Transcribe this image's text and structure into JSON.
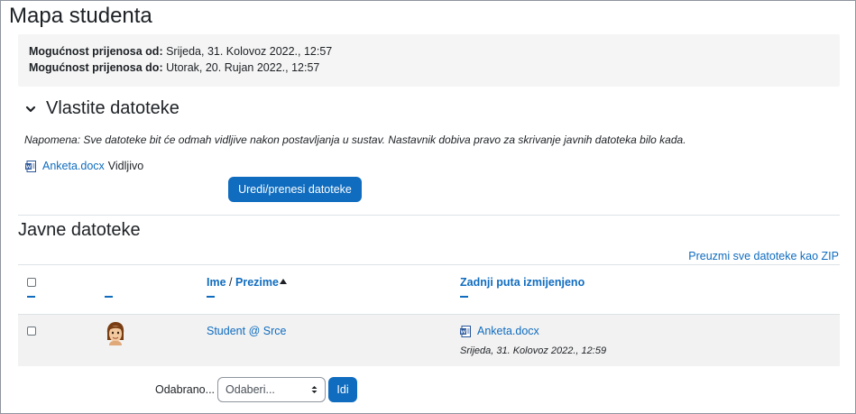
{
  "page": {
    "title": "Mapa studenta"
  },
  "availability": {
    "from_label": "Mogućnost prijenosa od:",
    "from_value": "Srijeda, 31. Kolovoz 2022., 12:57",
    "to_label": "Mogućnost prijenosa do:",
    "to_value": "Utorak, 20. Rujan 2022., 12:57"
  },
  "own_files": {
    "title": "Vlastite datoteke",
    "note": "Napomena: Sve datoteke bit će odmah vidljive nakon postavljanja u sustav. Nastavnik dobiva pravo za skrivanje javnih datoteka bilo kada.",
    "file_name": "Anketa.docx",
    "file_status": "Vidljivo",
    "edit_button": "Uredi/prenesi datoteke"
  },
  "public_files": {
    "title": "Javne datoteke",
    "download_all_link": "Preuzmi sve datoteke kao ZIP",
    "columns": {
      "first_name": "Ime",
      "separator": "/",
      "last_name": "Prezime",
      "last_modified": "Zadnji puta izmijenjeno"
    },
    "rows": [
      {
        "name": "Student @ Srce",
        "file_name": "Anketa.docx",
        "modified": "Srijeda, 31. Kolovoz 2022., 12:59"
      }
    ]
  },
  "bulk": {
    "label": "Odabrano...",
    "select_value": "Odaberi...",
    "go_button": "Idi"
  },
  "colors": {
    "primary": "#0f6cbf",
    "box_bg": "#f5f5f5",
    "row_bg": "#f2f2f2"
  },
  "icons": {
    "section_toggle": "chevron-down-icon",
    "file_type": "word-document-icon",
    "sort": "sort-ascending-icon",
    "user": "avatar",
    "select": "select-arrows-icon"
  }
}
